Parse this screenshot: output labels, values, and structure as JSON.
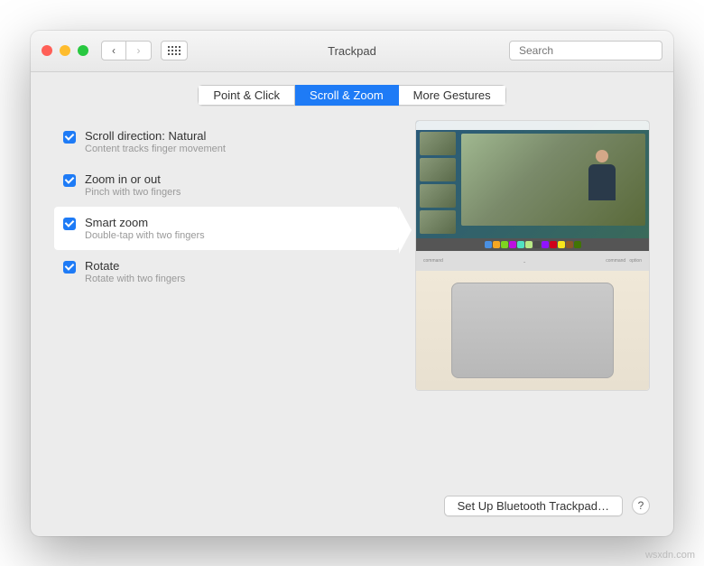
{
  "window": {
    "title": "Trackpad"
  },
  "search": {
    "placeholder": "Search"
  },
  "tabs": [
    {
      "label": "Point & Click",
      "active": false
    },
    {
      "label": "Scroll & Zoom",
      "active": true
    },
    {
      "label": "More Gestures",
      "active": false
    }
  ],
  "options": [
    {
      "title": "Scroll direction: Natural",
      "sub": "Content tracks finger movement",
      "checked": true,
      "selected": false
    },
    {
      "title": "Zoom in or out",
      "sub": "Pinch with two fingers",
      "checked": true,
      "selected": false
    },
    {
      "title": "Smart zoom",
      "sub": "Double-tap with two fingers",
      "checked": true,
      "selected": true
    },
    {
      "title": "Rotate",
      "sub": "Rotate with two fingers",
      "checked": true,
      "selected": false
    }
  ],
  "footer": {
    "bluetooth": "Set Up Bluetooth Trackpad…"
  },
  "watermark": "wsxdn.com"
}
